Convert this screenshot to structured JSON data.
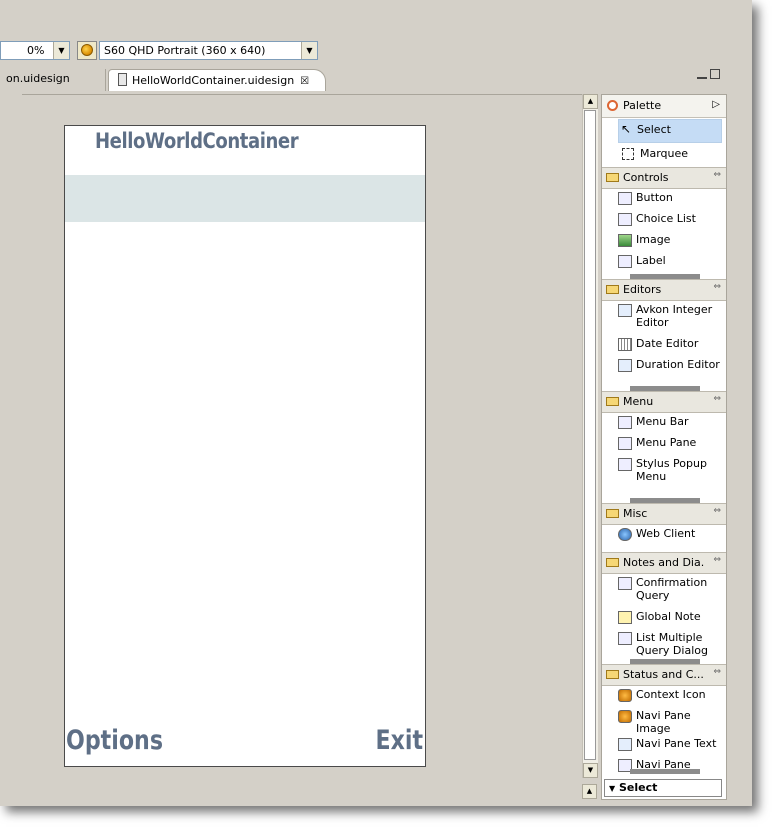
{
  "toolbar": {
    "zoom_value": "0%",
    "device_value": "S60 QHD Portrait (360 x 640)"
  },
  "tabs": [
    {
      "label": "on.uidesign"
    },
    {
      "label": "HelloWorldContainer.uidesign"
    }
  ],
  "screen": {
    "title": "HelloWorldContainer",
    "left_softkey": "Options",
    "right_softkey": "Exit"
  },
  "palette": {
    "title": "Palette",
    "tools": [
      "Select",
      "Marquee"
    ],
    "drawers": [
      {
        "label": "Controls",
        "items": [
          "Button",
          "Choice List",
          "Image",
          "Label"
        ]
      },
      {
        "label": "Editors",
        "items": [
          "Avkon Integer Editor",
          "Date Editor",
          "Duration Editor"
        ]
      },
      {
        "label": "Menu",
        "items": [
          "Menu Bar",
          "Menu Pane",
          "Stylus Popup Menu"
        ]
      },
      {
        "label": "Misc",
        "items": [
          "Web Client"
        ]
      },
      {
        "label": "Notes and Dia...",
        "items": [
          "Confirmation Query",
          "Global Note",
          "List Multiple Query Dialog"
        ]
      },
      {
        "label": "Status and C...",
        "items": [
          "Context Icon",
          "Navi Pane Image",
          "Navi Pane Text",
          "Navi Pane Volume"
        ]
      }
    ],
    "footer_select": "Select"
  }
}
